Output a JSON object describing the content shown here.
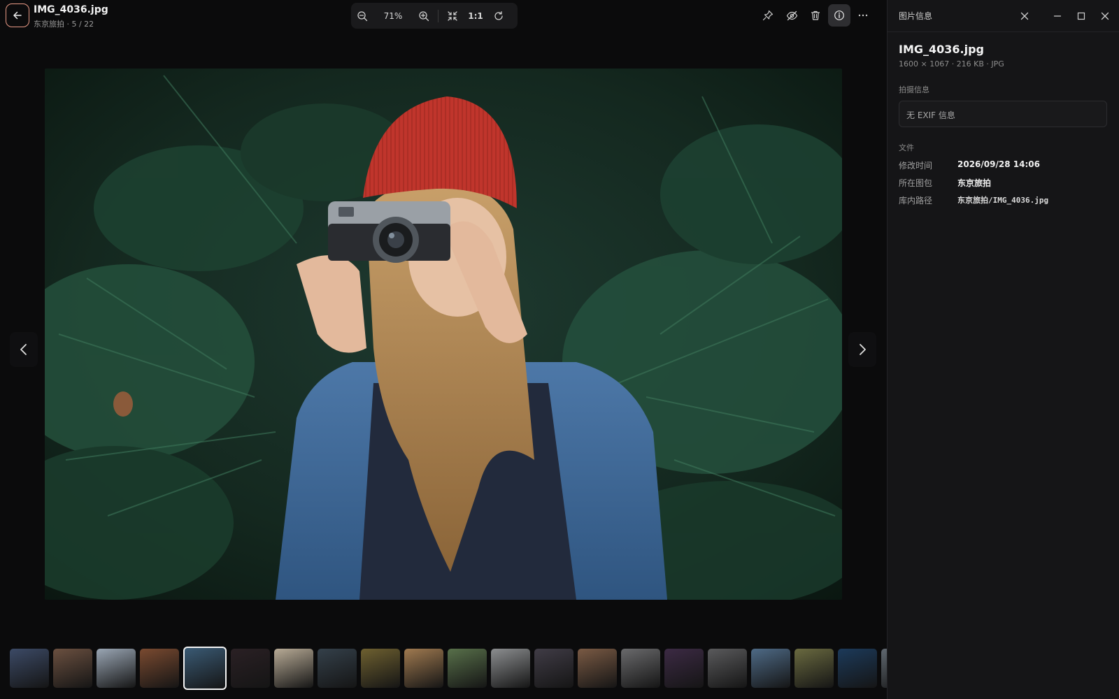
{
  "header": {
    "title": "IMG_4036.jpg",
    "subtitle": "东京旅拍 · 5 / 22",
    "zoom_value": "71%",
    "one_to_one": "1:1"
  },
  "icons": {
    "back": "arrow-left-icon",
    "zoom_out": "zoom-out-icon",
    "zoom_in": "zoom-in-icon",
    "fit": "fit-screen-icon",
    "rotate": "rotate-icon",
    "pin": "pin-icon",
    "hide": "eye-off-icon",
    "delete": "trash-icon",
    "info": "info-icon",
    "more": "more-horizontal-icon"
  },
  "filmstrip": {
    "selected_index": 4,
    "thumb_colors": [
      "#3c4a66",
      "#6b5040",
      "#9aa6b4",
      "#7a4a30",
      "#3a5a74",
      "#2a2024",
      "#b8ab96",
      "#34404a",
      "#6e6030",
      "#a07a50",
      "#58704a",
      "#8c8e90",
      "#403c46",
      "#7a5a44",
      "#6a6a6c",
      "#3c2a44",
      "#5a5a5c",
      "#4e6a86",
      "#6a6a40",
      "#1c3a5a",
      "#606870"
    ]
  },
  "panel": {
    "title": "图片信息",
    "filename": "IMG_4036.jpg",
    "meta": "1600 × 1067 · 216 KB · JPG",
    "shooting_label": "拍摄信息",
    "exif_empty": "无 EXIF 信息",
    "file_label": "文件",
    "rows": [
      {
        "key": "修改时间",
        "value": "2026/09/28 14:06"
      },
      {
        "key": "所在图包",
        "value": "东京旅拍"
      },
      {
        "key": "库内路径",
        "value_prefix": "东京旅拍/",
        "value_file": "IMG_4036.jpg"
      }
    ]
  },
  "colors": {
    "accent_ring": "#e99a86",
    "background": "#0b0b0c",
    "panel": "#151517"
  }
}
